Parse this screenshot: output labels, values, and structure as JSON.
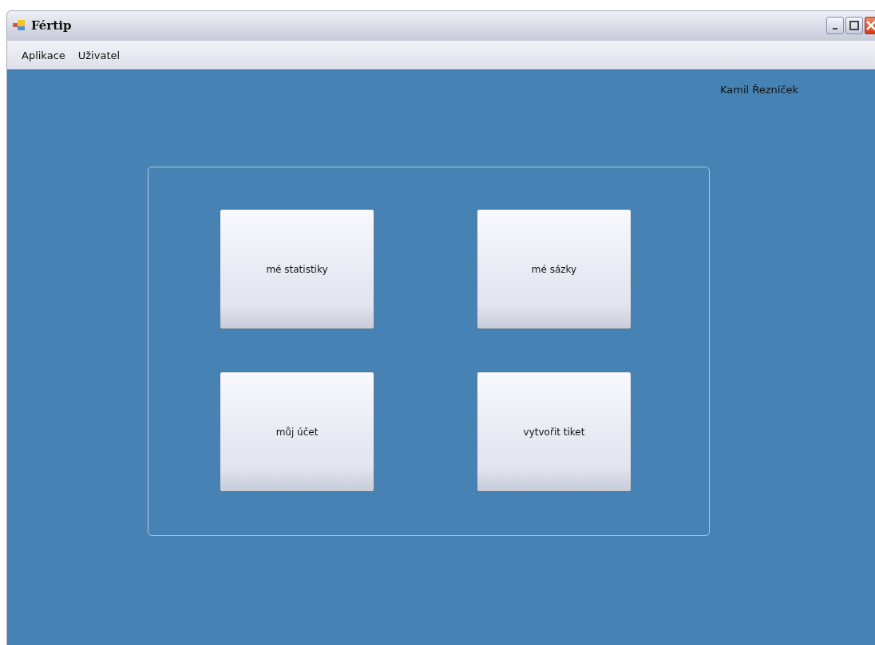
{
  "window": {
    "title": "Fértip"
  },
  "menu": [
    "Aplikace",
    "Uživatel"
  ],
  "user_name": "Kamil Řezníček",
  "buttons": [
    "mé statistiky",
    "mé sázky",
    "můj účet",
    "vytvořit tiket"
  ]
}
